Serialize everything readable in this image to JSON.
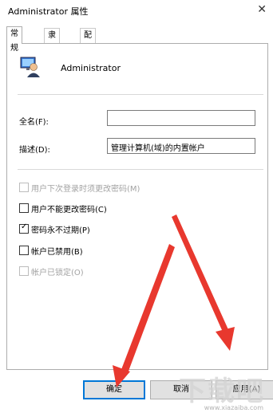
{
  "window": {
    "title": "Administrator 属性",
    "close_glyph": "✕"
  },
  "tabs": [
    {
      "label": "常规",
      "active": true
    },
    {
      "label": "隶属于",
      "active": false
    },
    {
      "label": "配置文件",
      "active": false
    }
  ],
  "user": {
    "name": "Administrator",
    "icon": "user-account-icon"
  },
  "fields": {
    "fullname_label": "全名(F):",
    "fullname_value": "",
    "description_label": "描述(D):",
    "description_value": "管理计算机(域)的内置帐户"
  },
  "checkboxes": [
    {
      "label": "用户下次登录时须更改密码(M)",
      "checked": false,
      "enabled": false
    },
    {
      "label": "用户不能更改密码(C)",
      "checked": false,
      "enabled": true
    },
    {
      "label": "密码永不过期(P)",
      "checked": true,
      "enabled": true
    },
    {
      "label": "帐户已禁用(B)",
      "checked": false,
      "enabled": true
    },
    {
      "label": "帐户已锁定(O)",
      "checked": false,
      "enabled": false
    }
  ],
  "buttons": {
    "ok": "确定",
    "cancel": "取消",
    "apply": "应用(A)"
  },
  "check_glyph": "✓",
  "annotation": {
    "arrow_color": "#e8382e"
  },
  "watermark": {
    "text": "下载吧",
    "url": "www.xiazaiba.com"
  }
}
